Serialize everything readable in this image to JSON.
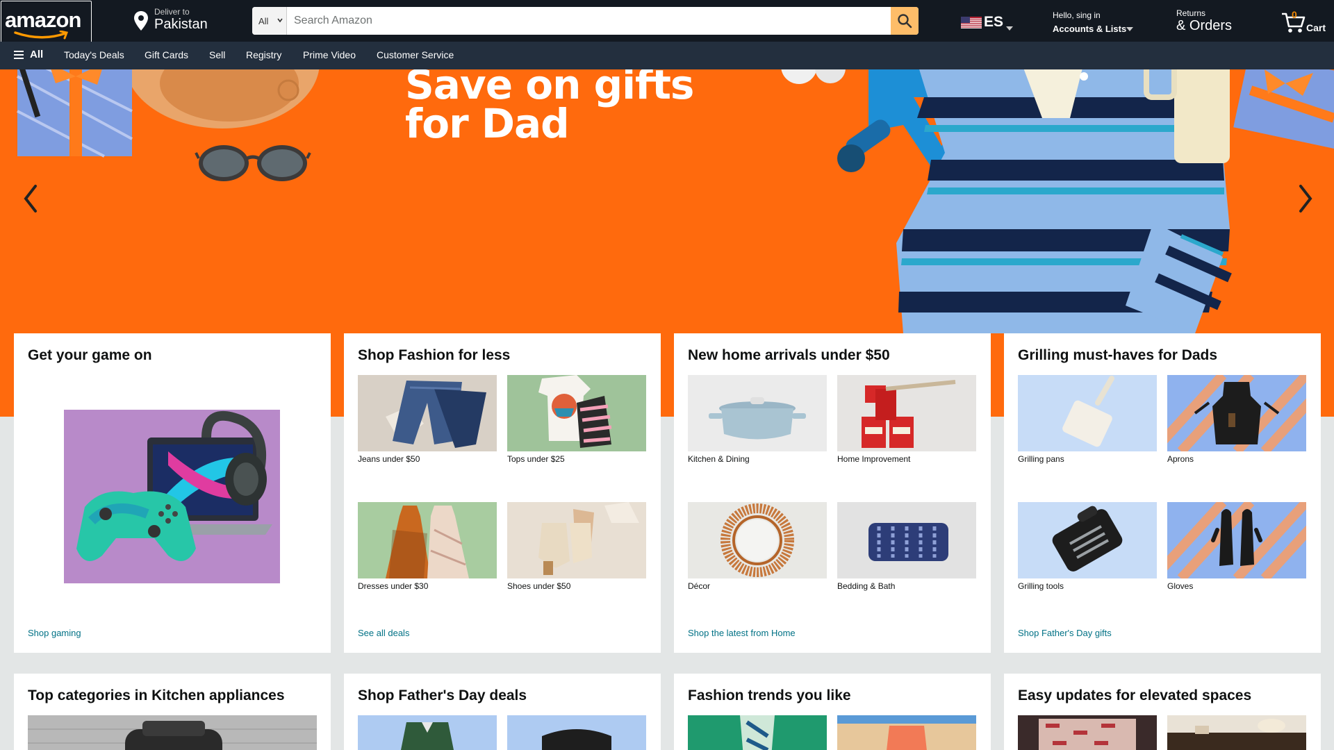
{
  "header": {
    "logo_text": "amazon",
    "deliver_to_label": "Deliver to",
    "deliver_to_location": "Pakistan",
    "search_category": "All",
    "search_placeholder": "Search Amazon",
    "language_code": "ES",
    "account_greeting": "Hello, sing in",
    "account_label": "Accounts & Lists",
    "returns_label": "Returns",
    "orders_label": "& Orders",
    "cart_count": "0",
    "cart_label": "Cart"
  },
  "subnav": {
    "all_label": "All",
    "items": [
      "Today's Deals",
      "Gift Cards",
      "Sell",
      "Registry",
      "Prime Video",
      "Customer Service"
    ]
  },
  "hero": {
    "title_line1": "Save on gifts",
    "title_line2": "for Dad"
  },
  "cards_row1": [
    {
      "title": "Get your game on",
      "link": "Shop gaming",
      "tiles": []
    },
    {
      "title": "Shop Fashion for less",
      "link": "See all deals",
      "tiles": [
        "Jeans under $50",
        "Tops under $25",
        "Dresses under $30",
        "Shoes under $50"
      ]
    },
    {
      "title": "New home arrivals under $50",
      "link": "Shop the latest from Home",
      "tiles": [
        "Kitchen & Dining",
        "Home Improvement",
        "Décor",
        "Bedding & Bath"
      ]
    },
    {
      "title": "Grilling must-haves for Dads",
      "link": "Shop Father's Day gifts",
      "tiles": [
        "Grilling pans",
        "Aprons",
        "Grilling tools",
        "Gloves"
      ]
    }
  ],
  "cards_row2": [
    {
      "title": "Top categories in Kitchen appliances"
    },
    {
      "title": "Shop Father's Day deals"
    },
    {
      "title": "Fashion trends you like"
    },
    {
      "title": "Easy updates for elevated spaces"
    }
  ],
  "colors": {
    "nav_dark": "#131921",
    "nav_sub": "#232f3e",
    "hero_orange": "#ff6a0d",
    "search_button": "#febd69",
    "link": "#007185"
  }
}
